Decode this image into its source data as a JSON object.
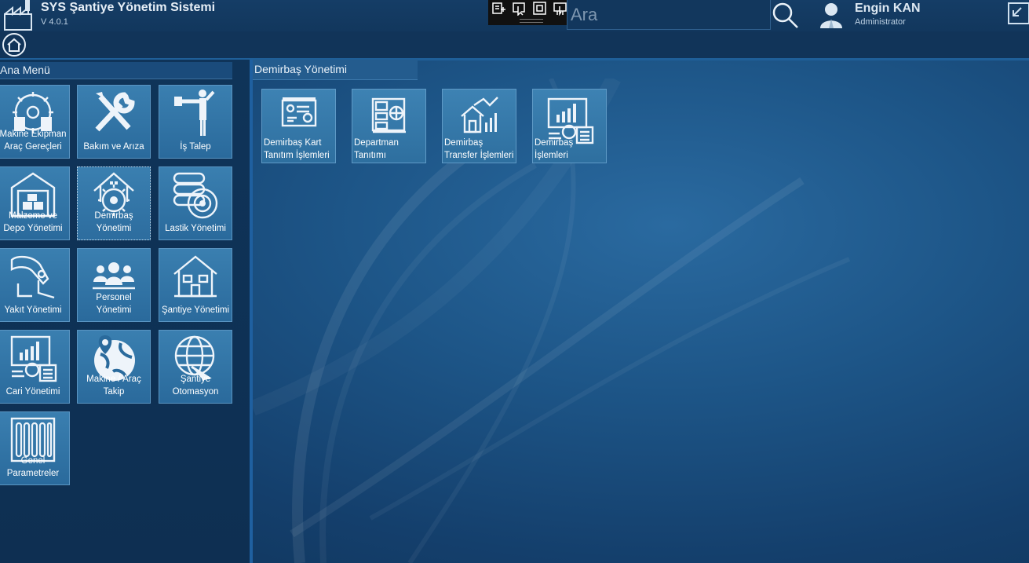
{
  "header": {
    "title": "SYS Şantiye Yönetim Sistemi",
    "version": "V 4.0.1",
    "search_placeholder": "Ara",
    "user_name": "Engin KAN",
    "user_role": "Administrator"
  },
  "left_menu": {
    "title": "Ana Menü",
    "items": [
      {
        "label_1": "Makine Ekipman",
        "label_2": "Araç Gereçleri",
        "icon": "machine-gear-icon"
      },
      {
        "label_1": "Bakım ve Arıza",
        "label_2": "",
        "icon": "wrench-screwdriver-icon"
      },
      {
        "label_1": "İş Talep",
        "label_2": "",
        "icon": "person-stop-icon"
      },
      {
        "label_1": "Malzeme ve",
        "label_2": "Depo Yönetimi",
        "icon": "warehouse-icon"
      },
      {
        "label_1": "Demirbaş",
        "label_2": "Yönetimi",
        "icon": "house-gear-icon"
      },
      {
        "label_1": "Lastik Yönetimi",
        "label_2": "",
        "icon": "tire-icon"
      },
      {
        "label_1": "Yakıt Yönetimi",
        "label_2": "",
        "icon": "fuel-nozzle-icon"
      },
      {
        "label_1": "Personel Yönetimi",
        "label_2": "",
        "icon": "people-icon"
      },
      {
        "label_1": "Şantiye Yönetimi",
        "label_2": "",
        "icon": "building-house-icon"
      },
      {
        "label_1": "Cari Yönetimi",
        "label_2": "",
        "icon": "finance-calculator-icon"
      },
      {
        "label_1": "Makine / Araç",
        "label_2": "Takip",
        "icon": "globe-pin-icon"
      },
      {
        "label_1": "Şantiye",
        "label_2": "Otomasyon",
        "icon": "globe-arrow-icon"
      },
      {
        "label_1": "Genel",
        "label_2": "Parametreler",
        "icon": "parameters-icon"
      }
    ],
    "selected_index": 4
  },
  "main": {
    "section_title": "Demirbaş Yönetimi",
    "tiles": [
      {
        "label_1": "Demirbaş Kart",
        "label_2": "Tanıtım İşlemleri",
        "icon": "card-presentation-icon"
      },
      {
        "label_1": "Departman",
        "label_2": "Tanıtımı",
        "icon": "calculator-compass-icon"
      },
      {
        "label_1": "Demirbaş",
        "label_2": "Transfer İşlemleri",
        "icon": "house-chart-icon"
      },
      {
        "label_1": "Demirbaş",
        "label_2": "İşlemleri",
        "icon": "finance-calculator-icon"
      }
    ]
  },
  "colors": {
    "background": "#1d5587",
    "tile": "#3a7fb0",
    "tile_border": "#5a95c2",
    "header": "#12375d",
    "divider": "#1f60a0"
  }
}
